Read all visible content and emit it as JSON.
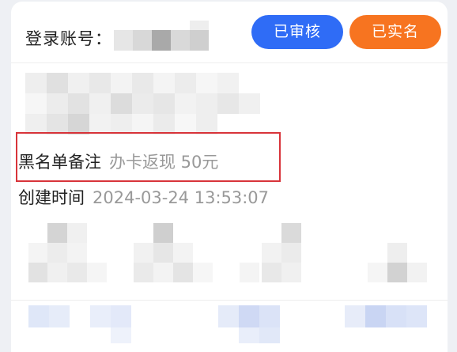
{
  "account": {
    "label": "登录账号："
  },
  "badges": {
    "reviewed": "已审核",
    "verified": "已实名"
  },
  "fields": {
    "blacklist_remark_label": "黑名单备注",
    "blacklist_remark_value": "办卡返现 50元",
    "created_time_label": "创建时间",
    "created_time_value": "2024-03-24 13:53:07"
  },
  "colors": {
    "reviewed_badge": "#2f6cf6",
    "verified_badge": "#f77420",
    "highlight_border": "#d8343a"
  }
}
